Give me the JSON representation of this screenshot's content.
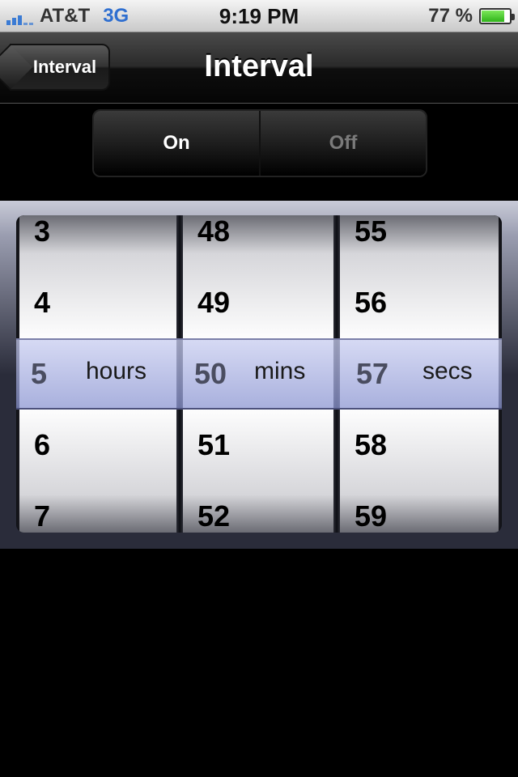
{
  "status_bar": {
    "carrier": "AT&T",
    "network": "3G",
    "time": "9:19 PM",
    "battery_percent": "77 %",
    "battery_level": 0.77
  },
  "nav": {
    "back_label": "Interval",
    "title": "Interval"
  },
  "segmented": {
    "on_label": "On",
    "off_label": "Off",
    "selected": "On"
  },
  "picker": {
    "hours": {
      "values": [
        "3",
        "4",
        "5",
        "6",
        "7"
      ],
      "selected": "5",
      "unit": "hours"
    },
    "mins": {
      "values": [
        "48",
        "49",
        "50",
        "51",
        "52"
      ],
      "selected": "50",
      "unit": "mins"
    },
    "secs": {
      "values": [
        "55",
        "56",
        "57",
        "58",
        "59"
      ],
      "selected": "57",
      "unit": "secs"
    }
  },
  "colors": {
    "network_blue": "#2f6fd0",
    "selection_tint": "#a9b0e0"
  }
}
